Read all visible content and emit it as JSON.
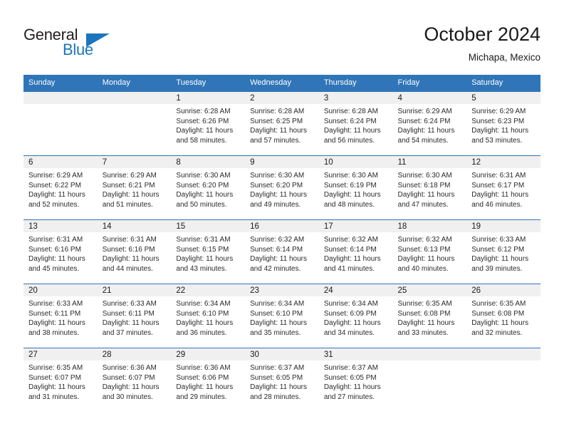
{
  "brand": {
    "name_part1": "General",
    "name_part2": "Blue",
    "flag_icon": "brand-flag-icon",
    "flag_color": "#1b75bc"
  },
  "header": {
    "title": "October 2024",
    "subtitle": "Michapa, Mexico",
    "header_bg": "#3075b8",
    "daynum_bg": "#f0f0f0"
  },
  "weekdays": [
    "Sunday",
    "Monday",
    "Tuesday",
    "Wednesday",
    "Thursday",
    "Friday",
    "Saturday"
  ],
  "labels": {
    "sunrise": "Sunrise:",
    "sunset": "Sunset:",
    "daylight": "Daylight:"
  },
  "weeks": [
    [
      {
        "day": "",
        "sunrise": "",
        "sunset": "",
        "daylight1": "",
        "daylight2": "",
        "empty": true
      },
      {
        "day": "",
        "sunrise": "",
        "sunset": "",
        "daylight1": "",
        "daylight2": "",
        "empty": true
      },
      {
        "day": "1",
        "sunrise": "Sunrise: 6:28 AM",
        "sunset": "Sunset: 6:26 PM",
        "daylight1": "Daylight: 11 hours",
        "daylight2": "and 58 minutes.",
        "empty": false
      },
      {
        "day": "2",
        "sunrise": "Sunrise: 6:28 AM",
        "sunset": "Sunset: 6:25 PM",
        "daylight1": "Daylight: 11 hours",
        "daylight2": "and 57 minutes.",
        "empty": false
      },
      {
        "day": "3",
        "sunrise": "Sunrise: 6:28 AM",
        "sunset": "Sunset: 6:24 PM",
        "daylight1": "Daylight: 11 hours",
        "daylight2": "and 56 minutes.",
        "empty": false
      },
      {
        "day": "4",
        "sunrise": "Sunrise: 6:29 AM",
        "sunset": "Sunset: 6:24 PM",
        "daylight1": "Daylight: 11 hours",
        "daylight2": "and 54 minutes.",
        "empty": false
      },
      {
        "day": "5",
        "sunrise": "Sunrise: 6:29 AM",
        "sunset": "Sunset: 6:23 PM",
        "daylight1": "Daylight: 11 hours",
        "daylight2": "and 53 minutes.",
        "empty": false
      }
    ],
    [
      {
        "day": "6",
        "sunrise": "Sunrise: 6:29 AM",
        "sunset": "Sunset: 6:22 PM",
        "daylight1": "Daylight: 11 hours",
        "daylight2": "and 52 minutes.",
        "empty": false
      },
      {
        "day": "7",
        "sunrise": "Sunrise: 6:29 AM",
        "sunset": "Sunset: 6:21 PM",
        "daylight1": "Daylight: 11 hours",
        "daylight2": "and 51 minutes.",
        "empty": false
      },
      {
        "day": "8",
        "sunrise": "Sunrise: 6:30 AM",
        "sunset": "Sunset: 6:20 PM",
        "daylight1": "Daylight: 11 hours",
        "daylight2": "and 50 minutes.",
        "empty": false
      },
      {
        "day": "9",
        "sunrise": "Sunrise: 6:30 AM",
        "sunset": "Sunset: 6:20 PM",
        "daylight1": "Daylight: 11 hours",
        "daylight2": "and 49 minutes.",
        "empty": false
      },
      {
        "day": "10",
        "sunrise": "Sunrise: 6:30 AM",
        "sunset": "Sunset: 6:19 PM",
        "daylight1": "Daylight: 11 hours",
        "daylight2": "and 48 minutes.",
        "empty": false
      },
      {
        "day": "11",
        "sunrise": "Sunrise: 6:30 AM",
        "sunset": "Sunset: 6:18 PM",
        "daylight1": "Daylight: 11 hours",
        "daylight2": "and 47 minutes.",
        "empty": false
      },
      {
        "day": "12",
        "sunrise": "Sunrise: 6:31 AM",
        "sunset": "Sunset: 6:17 PM",
        "daylight1": "Daylight: 11 hours",
        "daylight2": "and 46 minutes.",
        "empty": false
      }
    ],
    [
      {
        "day": "13",
        "sunrise": "Sunrise: 6:31 AM",
        "sunset": "Sunset: 6:16 PM",
        "daylight1": "Daylight: 11 hours",
        "daylight2": "and 45 minutes.",
        "empty": false
      },
      {
        "day": "14",
        "sunrise": "Sunrise: 6:31 AM",
        "sunset": "Sunset: 6:16 PM",
        "daylight1": "Daylight: 11 hours",
        "daylight2": "and 44 minutes.",
        "empty": false
      },
      {
        "day": "15",
        "sunrise": "Sunrise: 6:31 AM",
        "sunset": "Sunset: 6:15 PM",
        "daylight1": "Daylight: 11 hours",
        "daylight2": "and 43 minutes.",
        "empty": false
      },
      {
        "day": "16",
        "sunrise": "Sunrise: 6:32 AM",
        "sunset": "Sunset: 6:14 PM",
        "daylight1": "Daylight: 11 hours",
        "daylight2": "and 42 minutes.",
        "empty": false
      },
      {
        "day": "17",
        "sunrise": "Sunrise: 6:32 AM",
        "sunset": "Sunset: 6:14 PM",
        "daylight1": "Daylight: 11 hours",
        "daylight2": "and 41 minutes.",
        "empty": false
      },
      {
        "day": "18",
        "sunrise": "Sunrise: 6:32 AM",
        "sunset": "Sunset: 6:13 PM",
        "daylight1": "Daylight: 11 hours",
        "daylight2": "and 40 minutes.",
        "empty": false
      },
      {
        "day": "19",
        "sunrise": "Sunrise: 6:33 AM",
        "sunset": "Sunset: 6:12 PM",
        "daylight1": "Daylight: 11 hours",
        "daylight2": "and 39 minutes.",
        "empty": false
      }
    ],
    [
      {
        "day": "20",
        "sunrise": "Sunrise: 6:33 AM",
        "sunset": "Sunset: 6:11 PM",
        "daylight1": "Daylight: 11 hours",
        "daylight2": "and 38 minutes.",
        "empty": false
      },
      {
        "day": "21",
        "sunrise": "Sunrise: 6:33 AM",
        "sunset": "Sunset: 6:11 PM",
        "daylight1": "Daylight: 11 hours",
        "daylight2": "and 37 minutes.",
        "empty": false
      },
      {
        "day": "22",
        "sunrise": "Sunrise: 6:34 AM",
        "sunset": "Sunset: 6:10 PM",
        "daylight1": "Daylight: 11 hours",
        "daylight2": "and 36 minutes.",
        "empty": false
      },
      {
        "day": "23",
        "sunrise": "Sunrise: 6:34 AM",
        "sunset": "Sunset: 6:10 PM",
        "daylight1": "Daylight: 11 hours",
        "daylight2": "and 35 minutes.",
        "empty": false
      },
      {
        "day": "24",
        "sunrise": "Sunrise: 6:34 AM",
        "sunset": "Sunset: 6:09 PM",
        "daylight1": "Daylight: 11 hours",
        "daylight2": "and 34 minutes.",
        "empty": false
      },
      {
        "day": "25",
        "sunrise": "Sunrise: 6:35 AM",
        "sunset": "Sunset: 6:08 PM",
        "daylight1": "Daylight: 11 hours",
        "daylight2": "and 33 minutes.",
        "empty": false
      },
      {
        "day": "26",
        "sunrise": "Sunrise: 6:35 AM",
        "sunset": "Sunset: 6:08 PM",
        "daylight1": "Daylight: 11 hours",
        "daylight2": "and 32 minutes.",
        "empty": false
      }
    ],
    [
      {
        "day": "27",
        "sunrise": "Sunrise: 6:35 AM",
        "sunset": "Sunset: 6:07 PM",
        "daylight1": "Daylight: 11 hours",
        "daylight2": "and 31 minutes.",
        "empty": false
      },
      {
        "day": "28",
        "sunrise": "Sunrise: 6:36 AM",
        "sunset": "Sunset: 6:07 PM",
        "daylight1": "Daylight: 11 hours",
        "daylight2": "and 30 minutes.",
        "empty": false
      },
      {
        "day": "29",
        "sunrise": "Sunrise: 6:36 AM",
        "sunset": "Sunset: 6:06 PM",
        "daylight1": "Daylight: 11 hours",
        "daylight2": "and 29 minutes.",
        "empty": false
      },
      {
        "day": "30",
        "sunrise": "Sunrise: 6:37 AM",
        "sunset": "Sunset: 6:05 PM",
        "daylight1": "Daylight: 11 hours",
        "daylight2": "and 28 minutes.",
        "empty": false
      },
      {
        "day": "31",
        "sunrise": "Sunrise: 6:37 AM",
        "sunset": "Sunset: 6:05 PM",
        "daylight1": "Daylight: 11 hours",
        "daylight2": "and 27 minutes.",
        "empty": false
      },
      {
        "day": "",
        "sunrise": "",
        "sunset": "",
        "daylight1": "",
        "daylight2": "",
        "empty": true
      },
      {
        "day": "",
        "sunrise": "",
        "sunset": "",
        "daylight1": "",
        "daylight2": "",
        "empty": true
      }
    ]
  ]
}
